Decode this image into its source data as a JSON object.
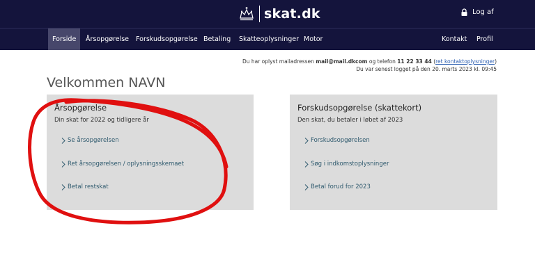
{
  "header": {
    "logo_text": "skat.dk",
    "logout_label": "Log af",
    "icons": {
      "logo": "crown-icon",
      "logout": "lock-icon"
    }
  },
  "nav": {
    "left": [
      "Forside",
      "Årsopgørelse",
      "Forskudsopgørelse",
      "Betaling",
      "Skatteoplysninger",
      "Motor"
    ],
    "right": [
      "Kontakt",
      "Profil"
    ],
    "active": "Forside"
  },
  "info": {
    "line1_prefix": "Du har oplyst mailadressen",
    "email": "mail@mail.dkcom",
    "line1_mid": "og telefon",
    "phone": "11 22 33 44",
    "edit_link": "ret kontaktoplysninger",
    "line2": "Du var senest logget på den 20. marts 2023 kl. 09:45"
  },
  "welcome": "Velkommen NAVN",
  "cards": [
    {
      "title": "Årsopgørelse",
      "subtitle": "Din skat for 2022 og tidligere år",
      "links": [
        "Se årsopgørelsen",
        "Ret årsopgørelsen / oplysningsskemaet",
        "Betal restskat"
      ]
    },
    {
      "title": "Forskudsopgørelse (skattekort)",
      "subtitle": "Den skat, du betaler i løbet af 2023",
      "links": [
        "Forskudsopgørelsen",
        "Søg i indkomstoplysninger",
        "Betal forud for 2023"
      ]
    }
  ],
  "colors": {
    "header_bg": "#14143c",
    "active_tab": "#47476b",
    "card_bg": "#dcdcdc",
    "annotation": "#e01010",
    "link": "#2f5a6e"
  }
}
